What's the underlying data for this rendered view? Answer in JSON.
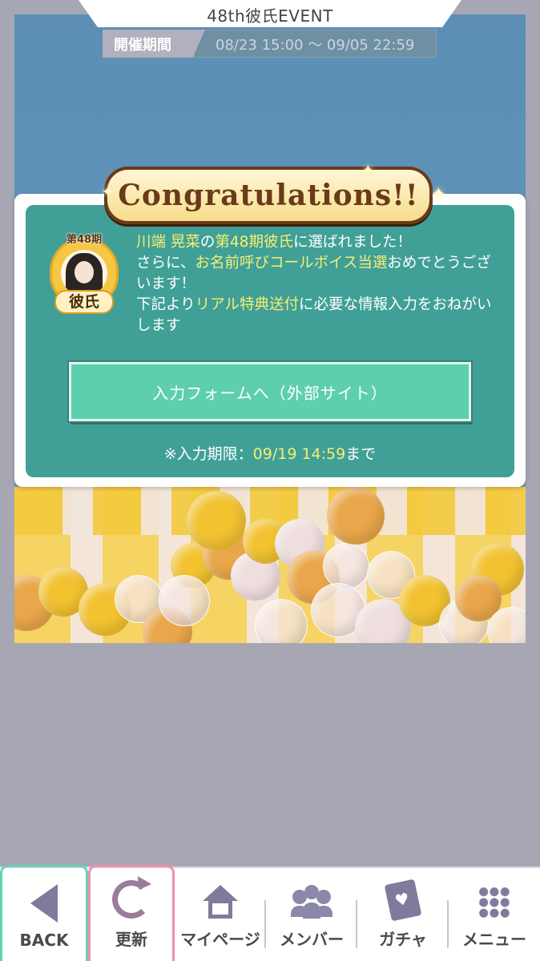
{
  "header": {
    "title": "48th彼氏EVENT",
    "period_label": "開催期間",
    "period_value": "08/23 15:00 〜 09/05 22:59"
  },
  "dialog": {
    "banner": "Congratulations!!",
    "badge": {
      "term": "第48期",
      "label": "彼氏"
    },
    "message": {
      "line1_name": "川端 晃菜",
      "line1_mid": "の",
      "line1_hl": "第48期彼氏",
      "line1_end": "に選ばれました！",
      "line2_start": "さらに、",
      "line2_hl": "お名前呼びコールボイス当選",
      "line2_end": "おめでとうございます！",
      "line3_start": "下記より",
      "line3_hl": "リアル特典送付",
      "line3_end": "に必要な情報入力をおねがいします"
    },
    "form_button": "入力フォームへ（外部サイト）",
    "deadline_prefix": "※入力期限：",
    "deadline_value": "09/19 14:59",
    "deadline_suffix": "まで"
  },
  "nav": {
    "back": "BACK",
    "refresh": "更新",
    "mypage": "マイページ",
    "members": "メンバー",
    "gacha": "ガチャ",
    "menu": "メニュー"
  },
  "colors": {
    "accent_teal": "#40a097",
    "highlight": "#f7ee73",
    "button": "#5dcfad",
    "nav_icon": "#7e7b9c"
  }
}
